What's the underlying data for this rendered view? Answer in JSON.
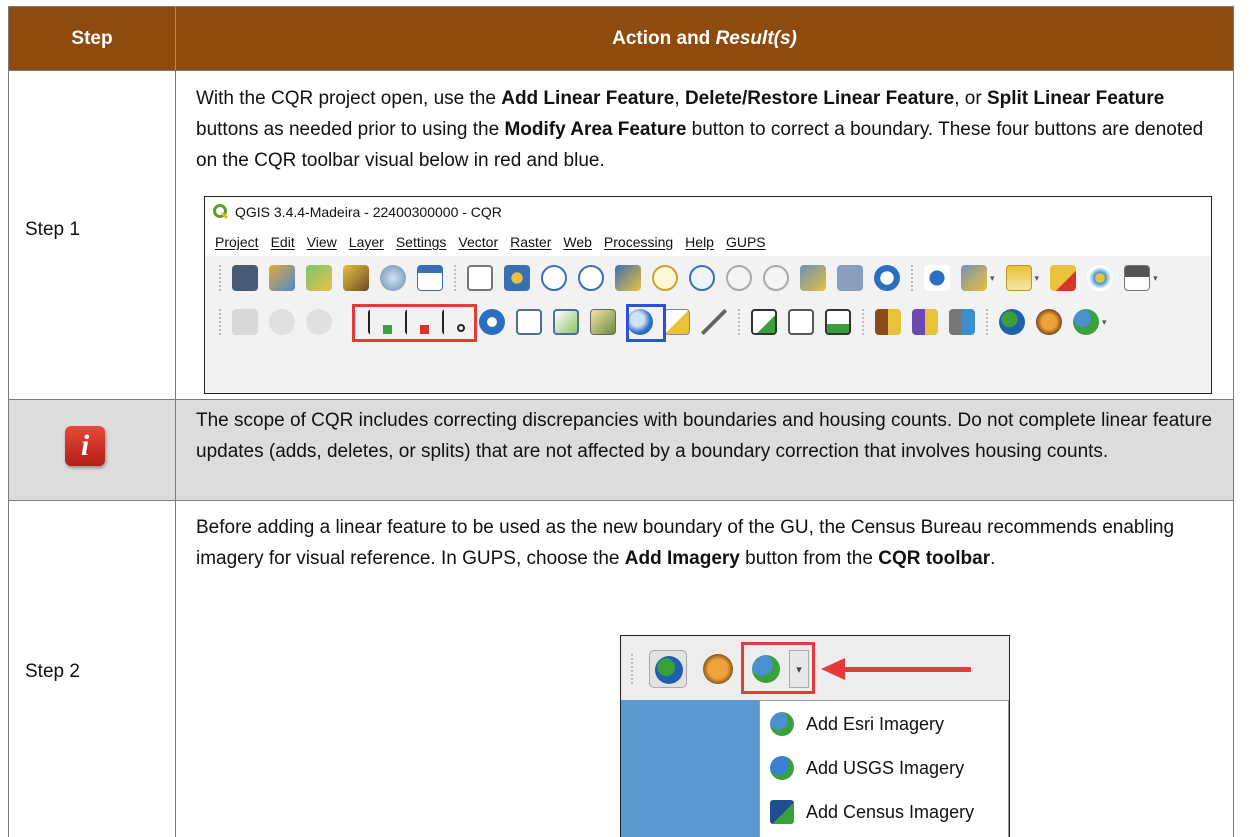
{
  "header": {
    "step_label": "Step",
    "action_label": "Action and ",
    "action_result": "Result(s)"
  },
  "step1": {
    "label": "Step 1",
    "text": {
      "t1": "With the CQR project open, use the ",
      "b1": "Add Linear Feature",
      "t2": ", ",
      "b2": "Delete/Restore Linear Feature",
      "t3": ", or ",
      "b3": "Split Linear Feature",
      "t4": " buttons as needed prior to using the ",
      "b4": "Modify Area Feature",
      "t5": " button to correct a boundary. These four buttons are denoted on the CQR toolbar visual below in red and blue."
    },
    "qgis": {
      "title": "QGIS 3.4.4-Madeira - 22400300000 - CQR",
      "menu": [
        "Project",
        "Edit",
        "View",
        "Layer",
        "Settings",
        "Vector",
        "Raster",
        "Web",
        "Processing",
        "Help",
        "GUPS"
      ]
    }
  },
  "note": {
    "icon": "info-icon",
    "text": "The scope of CQR includes correcting discrepancies with boundaries and housing counts. Do not complete linear feature updates (adds, deletes, or splits) that are not affected by a boundary correction that involves housing counts."
  },
  "step2": {
    "label": "Step 2",
    "text": {
      "t1": "Before adding a linear feature to be used as the new boundary of the GU, the Census Bureau recommends enabling imagery for visual reference. In GUPS, choose the ",
      "b1": "Add Imagery",
      "t2": " button from the ",
      "b2": "CQR toolbar",
      "t3": "."
    },
    "menu_items": [
      "Add Esri Imagery",
      "Add USGS Imagery",
      "Add Census Imagery"
    ]
  },
  "colors": {
    "header_bg": "#8f4a0d",
    "note_bg": "#dcdcdc",
    "highlight_red": "#e53a3a",
    "highlight_blue": "#2b4fe0"
  }
}
